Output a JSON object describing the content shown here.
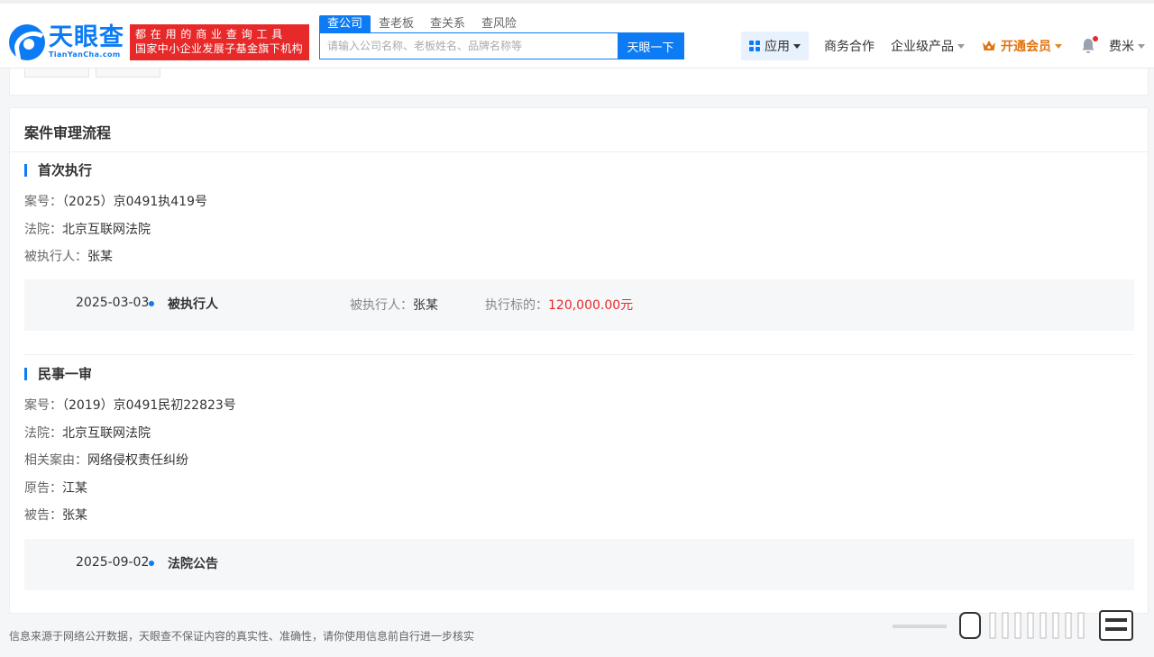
{
  "header": {
    "logo_cn": "天眼查",
    "logo_en": "TianYanCha.com",
    "slogan_line1": "都在用的商业查询工具",
    "slogan_line2": "国家中小企业发展子基金旗下机构",
    "search_tabs": [
      "查公司",
      "查老板",
      "查关系",
      "查风险"
    ],
    "search_placeholder": "请输入公司名称、老板姓名、品牌名称等",
    "search_button": "天眼一下",
    "nav": {
      "apps": "应用",
      "business": "商务合作",
      "enterprise": "企业级产品",
      "vip": "开通会员",
      "user": "费米"
    }
  },
  "card": {
    "title": "案件审理流程",
    "sections": [
      {
        "title": "首次执行",
        "lines": [
          {
            "label": "案号：",
            "value": "（2025）京0491执419号"
          },
          {
            "label": "法院：",
            "value": "北京互联网法院"
          },
          {
            "label": "被执行人：",
            "value": "张某"
          }
        ],
        "timeline": {
          "date": "2025-03-03",
          "event": "被执行人",
          "party_label": "被执行人：",
          "party_value": "张某",
          "amount_label": "执行标的：",
          "amount_value": "120,000.00元"
        }
      },
      {
        "title": "民事一审",
        "lines": [
          {
            "label": "案号：",
            "value": "（2019）京0491民初22823号"
          },
          {
            "label": "法院：",
            "value": "北京互联网法院"
          },
          {
            "label": "相关案由：",
            "value": "网络侵权责任纠纷"
          },
          {
            "label": "原告：",
            "value": "江某"
          },
          {
            "label": "被告：",
            "value": "张某"
          }
        ],
        "timeline": {
          "date": "2025-09-02",
          "event": "法院公告"
        }
      }
    ]
  },
  "footer": {
    "note": "信息来源于网络公开数据，天眼查不保证内容的真实性、准确性，请你使用信息前自行进一步核实"
  },
  "colors": {
    "brand_blue": "#0d7bf3",
    "red": "#e8292a",
    "vip_orange": "#e2730f"
  }
}
